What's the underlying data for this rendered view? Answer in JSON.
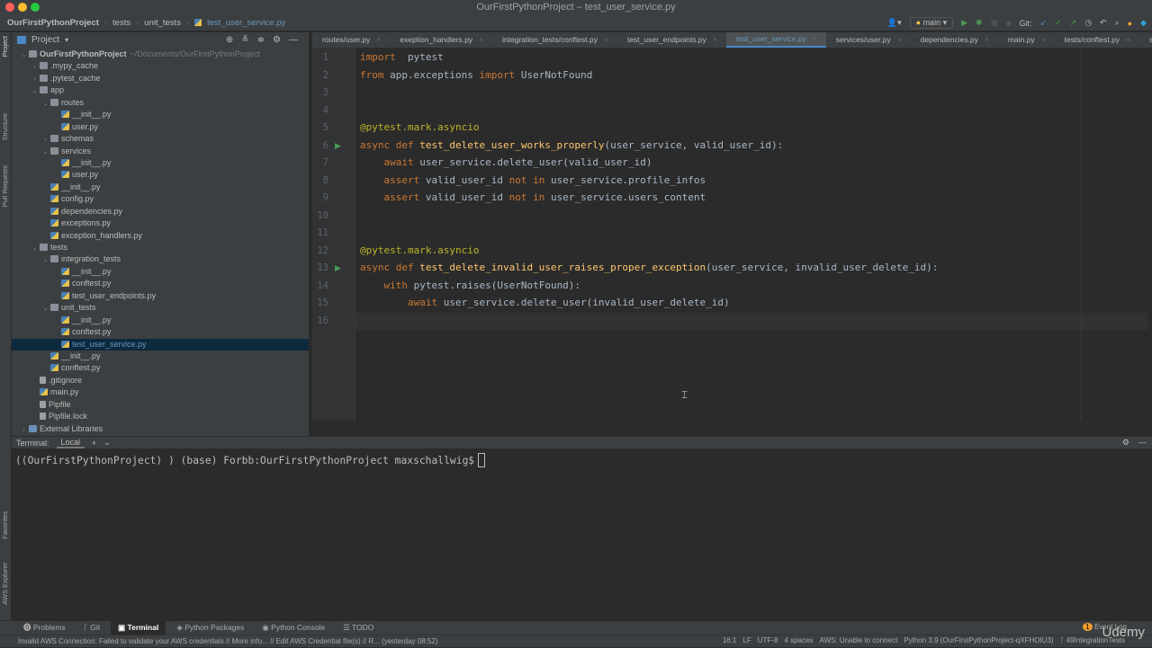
{
  "window": {
    "title": "OurFirstPythonProject – test_user_service.py"
  },
  "breadcrumb": [
    "OurFirstPythonProject",
    "tests",
    "unit_tests",
    "test_user_service.py"
  ],
  "toolbar": {
    "branch": "main",
    "git_label": "Git:"
  },
  "project_panel": {
    "title": "Project",
    "root_path": "~/Documents/OurFirstPythonProject"
  },
  "tree": [
    {
      "level": 0,
      "label": "OurFirstPythonProject",
      "type": "folder",
      "expanded": true,
      "bold": true
    },
    {
      "level": 1,
      "label": ".mypy_cache",
      "type": "folder",
      "expanded": false
    },
    {
      "level": 1,
      "label": ".pytest_cache",
      "type": "folder",
      "expanded": false
    },
    {
      "level": 1,
      "label": "app",
      "type": "folder",
      "expanded": true
    },
    {
      "level": 2,
      "label": "routes",
      "type": "folder",
      "expanded": true
    },
    {
      "level": 3,
      "label": "__init__.py",
      "type": "py"
    },
    {
      "level": 3,
      "label": "user.py",
      "type": "py"
    },
    {
      "level": 2,
      "label": "schemas",
      "type": "folder",
      "expanded": false
    },
    {
      "level": 2,
      "label": "services",
      "type": "folder",
      "expanded": true
    },
    {
      "level": 3,
      "label": "__init__.py",
      "type": "py"
    },
    {
      "level": 3,
      "label": "user.py",
      "type": "py"
    },
    {
      "level": 2,
      "label": "__init__.py",
      "type": "py"
    },
    {
      "level": 2,
      "label": "config.py",
      "type": "py"
    },
    {
      "level": 2,
      "label": "dependencies.py",
      "type": "py"
    },
    {
      "level": 2,
      "label": "exceptions.py",
      "type": "py"
    },
    {
      "level": 2,
      "label": "exception_handlers.py",
      "type": "py"
    },
    {
      "level": 1,
      "label": "tests",
      "type": "folder",
      "expanded": true
    },
    {
      "level": 2,
      "label": "integration_tests",
      "type": "folder",
      "expanded": true
    },
    {
      "level": 3,
      "label": "__init__.py",
      "type": "py"
    },
    {
      "level": 3,
      "label": "conftest.py",
      "type": "py"
    },
    {
      "level": 3,
      "label": "test_user_endpoints.py",
      "type": "py"
    },
    {
      "level": 2,
      "label": "unit_tests",
      "type": "folder",
      "expanded": true
    },
    {
      "level": 3,
      "label": "__init__.py",
      "type": "py"
    },
    {
      "level": 3,
      "label": "conftest.py",
      "type": "py"
    },
    {
      "level": 3,
      "label": "test_user_service.py",
      "type": "py",
      "selected": true
    },
    {
      "level": 2,
      "label": "__init__.py",
      "type": "py"
    },
    {
      "level": 2,
      "label": "conftest.py",
      "type": "py"
    },
    {
      "level": 1,
      "label": ".gitignore",
      "type": "file"
    },
    {
      "level": 1,
      "label": "main.py",
      "type": "py"
    },
    {
      "level": 1,
      "label": "Pipfile",
      "type": "file"
    },
    {
      "level": 1,
      "label": "Pipfile.lock",
      "type": "file"
    },
    {
      "level": 0,
      "label": "External Libraries",
      "type": "lib",
      "expanded": false
    }
  ],
  "tabs": [
    {
      "label": "routes/user.py"
    },
    {
      "label": "exeption_handlers.py"
    },
    {
      "label": "integration_tests/conftest.py"
    },
    {
      "label": "test_user_endpoints.py"
    },
    {
      "label": "test_user_service.py",
      "active": true
    },
    {
      "label": "services/user.py"
    },
    {
      "label": "dependencies.py"
    },
    {
      "label": "main.py"
    },
    {
      "label": "tests/conftest.py"
    },
    {
      "label": "schem"
    }
  ],
  "code": [
    {
      "n": "1",
      "t": [
        [
          "k",
          "import"
        ],
        [
          "",
          "  pytest"
        ]
      ]
    },
    {
      "n": "2",
      "t": [
        [
          "k",
          "from"
        ],
        [
          "",
          " app.exceptions "
        ],
        [
          "k",
          "import"
        ],
        [
          "",
          " UserNotFound"
        ]
      ]
    },
    {
      "n": "3",
      "t": []
    },
    {
      "n": "4",
      "t": []
    },
    {
      "n": "5",
      "t": [
        [
          "d",
          "@pytest.mark.asyncio"
        ]
      ]
    },
    {
      "n": "6",
      "run": true,
      "t": [
        [
          "k",
          "async def "
        ],
        [
          "f",
          "test_delete_user_works_properly"
        ],
        [
          "",
          "(user_service, valid_user_id):"
        ]
      ]
    },
    {
      "n": "7",
      "t": [
        [
          "",
          "    "
        ],
        [
          "k",
          "await"
        ],
        [
          "",
          " user_service.delete_user(valid_user_id)"
        ]
      ]
    },
    {
      "n": "8",
      "t": [
        [
          "",
          "    "
        ],
        [
          "k",
          "assert"
        ],
        [
          "",
          " valid_user_id "
        ],
        [
          "k",
          "not in"
        ],
        [
          "",
          " user_service.profile_infos"
        ]
      ]
    },
    {
      "n": "9",
      "t": [
        [
          "",
          "    "
        ],
        [
          "k",
          "assert"
        ],
        [
          "",
          " valid_user_id "
        ],
        [
          "k",
          "not in"
        ],
        [
          "",
          " user_service.users_content"
        ]
      ]
    },
    {
      "n": "10",
      "t": []
    },
    {
      "n": "11",
      "t": []
    },
    {
      "n": "12",
      "t": [
        [
          "d",
          "@pytest.mark.asyncio"
        ]
      ]
    },
    {
      "n": "13",
      "run": true,
      "t": [
        [
          "k",
          "async def "
        ],
        [
          "f",
          "test_delete_invalid_user_raises_proper_exception"
        ],
        [
          "",
          "(user_service, invalid_user_delete_id):"
        ]
      ]
    },
    {
      "n": "14",
      "t": [
        [
          "",
          "    "
        ],
        [
          "k",
          "with"
        ],
        [
          "",
          " pytest.raises(UserNotFound):"
        ]
      ]
    },
    {
      "n": "15",
      "t": [
        [
          "",
          "        "
        ],
        [
          "k",
          "await"
        ],
        [
          "",
          " user_service.delete_user(invalid_user_delete_id)"
        ]
      ]
    },
    {
      "n": "16",
      "t": []
    }
  ],
  "terminal": {
    "label": "Terminal:",
    "tab": "Local",
    "prompt": "((OurFirstPythonProject) ) (base) Forbb:OurFirstPythonProject maxschallwig$"
  },
  "left_stripe": [
    "Project",
    "Structure",
    "Pull Requests",
    "Favorites",
    "AWS Explorer"
  ],
  "bottom_tabs": [
    {
      "label": "Problems"
    },
    {
      "label": "Git"
    },
    {
      "label": "Terminal",
      "active": true
    },
    {
      "label": "Python Packages"
    },
    {
      "label": "Python Console"
    },
    {
      "label": "TODO"
    }
  ],
  "status": {
    "message": "Invalid AWS Connection: Failed to validate your AWS credentials // More info... // Edit AWS Credential file(s) // R... (yesterday 08:52)",
    "position": "16:1",
    "line_sep": "LF",
    "encoding": "UTF-8",
    "indent": "4 spaces",
    "aws": "AWS: Unable to connect",
    "interpreter": "Python 3.9 (OurFirstPythonProject-qXFHOIU3)",
    "branch": "49IntegrationTests",
    "event_log": "Event Log",
    "event_count": "1"
  },
  "watermark": "Udemy",
  "colors": {
    "keyword": "#cc7832",
    "decorator": "#bbb529",
    "function": "#ffc66d",
    "text": "#a9b7c6",
    "accent": "#4a88c7"
  }
}
